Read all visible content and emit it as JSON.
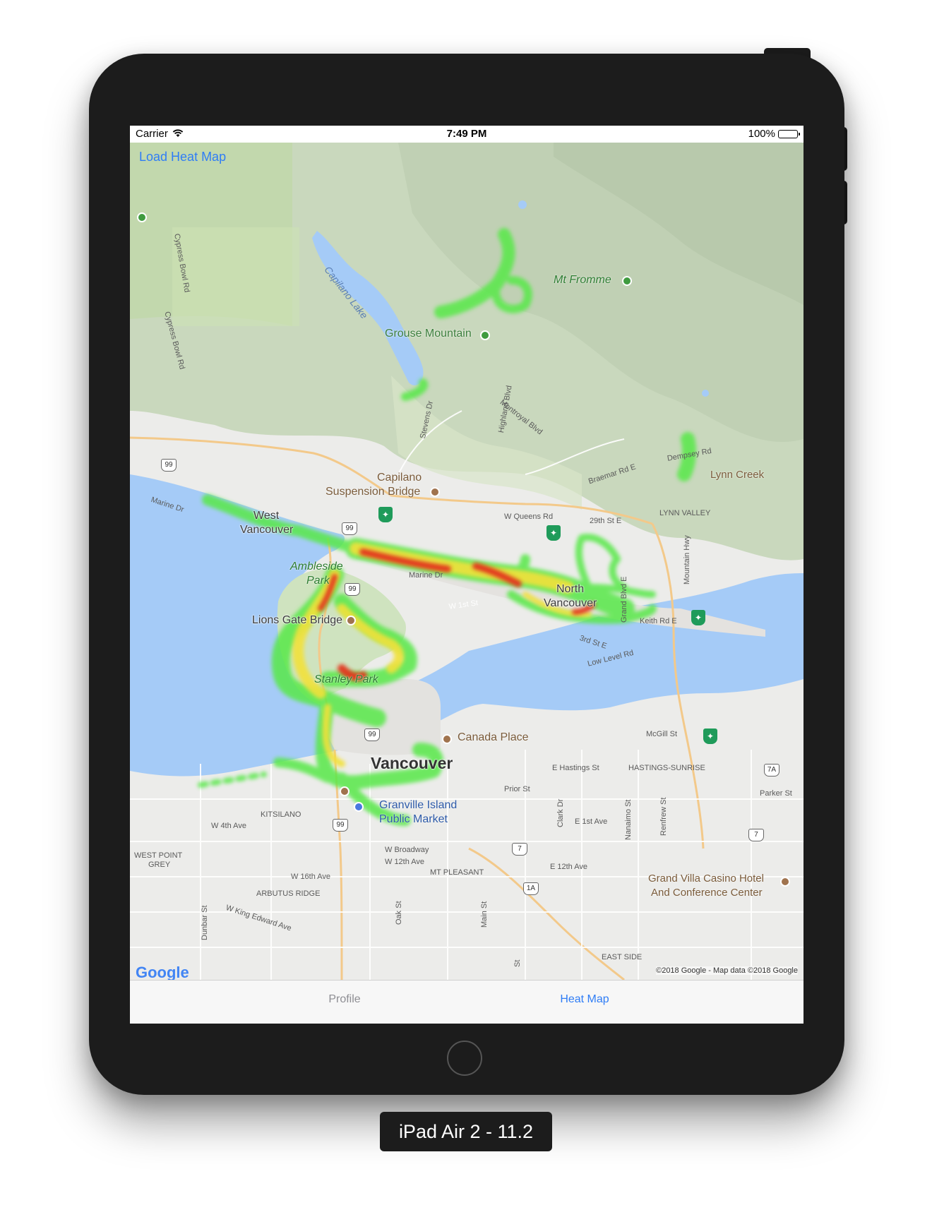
{
  "status_bar": {
    "carrier": "Carrier",
    "time": "7:49 PM",
    "battery": "100%"
  },
  "nav": {
    "load_button": "Load Heat Map"
  },
  "map": {
    "labels": {
      "capilano_lake": "Capilano Lake",
      "mt_fromme": "Mt Fromme",
      "grouse_mountain": "Grouse Mountain",
      "cypress_bowl_rd_1": "Cypress Bowl Rd",
      "cypress_bowl_rd_2": "Cypress Bowl Rd",
      "montroyal_blvd": "Montroyal Blvd",
      "highland_blvd": "Highland Blvd",
      "stevens_dr": "Stevens Dr",
      "dempsey_rd": "Dempsey Rd",
      "braemar_rd": "Braemar Rd E",
      "lynn_creek": "Lynn Creek",
      "capilano_bridge_1": "Capilano",
      "capilano_bridge_2": "Suspension Bridge",
      "marine_dr_west": "Marine Dr",
      "west_vancouver_1": "West",
      "west_vancouver_2": "Vancouver",
      "w_queens_rd": "W Queens Rd",
      "st_29th": "29th St E",
      "lynn_valley": "LYNN VALLEY",
      "mountain_hwy": "Mountain Hwy",
      "ambleside_1": "Ambleside",
      "ambleside_2": "Park",
      "marine_dr": "Marine Dr",
      "north_van_1": "North",
      "north_van_2": "Vancouver",
      "grand_blvd": "Grand Blvd E",
      "w_1st_st": "W 1st St",
      "keith_rd": "Keith Rd E",
      "st_3rd": "3rd St E",
      "low_level_rd": "Low Level Rd",
      "lions_gate": "Lions Gate Bridge",
      "stanley_park": "Stanley Park",
      "canada_place": "Canada Place",
      "mcgill_st": "McGill St",
      "vancouver": "Vancouver",
      "e_hastings": "E Hastings St",
      "hastings_sunrise": "HASTINGS-SUNRISE",
      "prior_st": "Prior St",
      "parker_st": "Parker St",
      "granville_1": "Granville Island",
      "granville_2": "Public Market",
      "kitsilano": "KITSILANO",
      "w_4th_ave": "W 4th Ave",
      "clark_dr": "Clark Dr",
      "e_1st_ave": "E 1st Ave",
      "nanaimo_st": "Nanaimo St",
      "renfrew_st": "Renfrew St",
      "west_point_grey_1": "WEST POINT",
      "west_point_grey_2": "GREY",
      "w_broadway": "W Broadway",
      "w_12th_ave": "W 12th Ave",
      "w_16th_ave": "W 16th Ave",
      "mt_pleasant": "MT PLEASANT",
      "e_12th_ave": "E 12th Ave",
      "arbutus_ridge": "ARBUTUS RIDGE",
      "w_king_edward": "W King Edward Ave",
      "dunbar_st": "Dunbar St",
      "oak_st": "Oak St",
      "main_st": "Main St",
      "st_short": "St",
      "east_side": "EAST SIDE",
      "grand_villa_1": "Grand Villa Casino Hotel",
      "grand_villa_2": "And Conference Center"
    },
    "shields": {
      "hwy99_a": "99",
      "hwy99_b": "99",
      "hwy99_c": "99",
      "hwy99_d": "99",
      "hwy99_e": "99",
      "hwy7a": "7A",
      "hwy7_a": "7",
      "hwy7_b": "7",
      "hwy1a": "1A"
    },
    "google_logo": "Google",
    "attribution": "©2018 Google - Map data ©2018 Google"
  },
  "tab_bar": {
    "tabs": [
      {
        "label": "Profile",
        "selected": false
      },
      {
        "label": "Heat Map",
        "selected": true
      }
    ]
  },
  "simulator_label": "iPad Air 2 - 11.2",
  "colors": {
    "accent": "#2f7df6",
    "water": "#a5cbf7",
    "land": "#e9e9e6",
    "park": "#cfe3bf"
  }
}
